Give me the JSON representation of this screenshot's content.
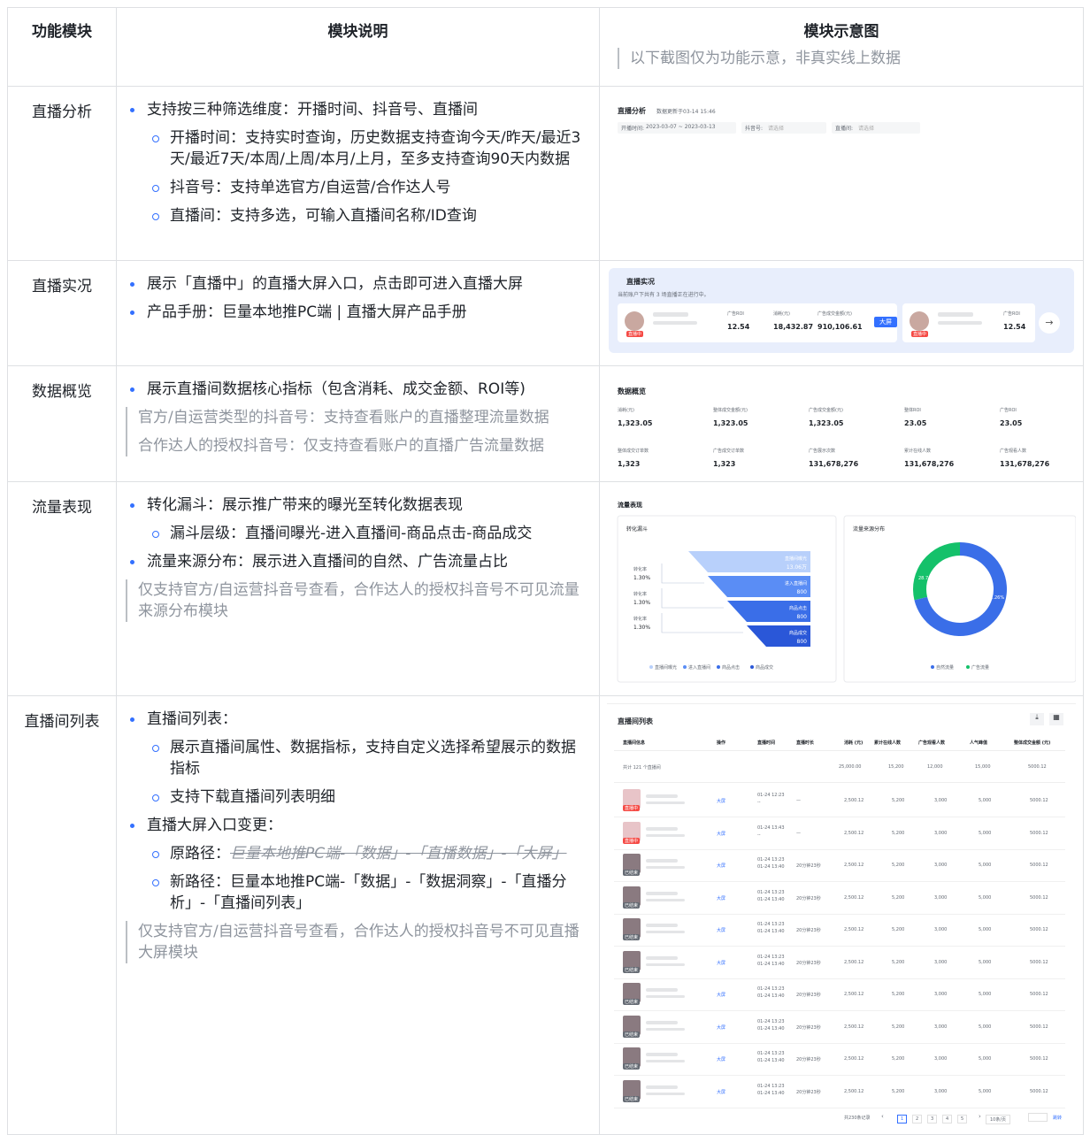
{
  "header": {
    "col1": "功能模块",
    "col2": "模块说明",
    "col3": "模块示意图",
    "col3_hint": "以下截图仅为功能示意，非真实线上数据"
  },
  "rows": [
    {
      "module": "直播分析",
      "items": [
        {
          "level": 1,
          "text": "支持按三种筛选维度：开播时间、抖音号、直播间"
        },
        {
          "level": 2,
          "text": "开播时间：支持实时查询，历史数据支持查询今天/昨天/最近3天/最近7天/本周/上周/本月/上月，至多支持查询90天内数据"
        },
        {
          "level": 2,
          "text": "抖音号：支持单选官方/自运营/合作达人号"
        },
        {
          "level": 2,
          "text": "直播间：支持多选，可输入直播间名称/ID查询"
        }
      ]
    },
    {
      "module": "直播实况",
      "items": [
        {
          "level": 1,
          "text": "展示「直播中」的直播大屏入口，点击即可进入直播大屏"
        },
        {
          "level": 1,
          "text": "产品手册：巨量本地推PC端 | 直播大屏产品手册"
        }
      ]
    },
    {
      "module": "数据概览",
      "items": [
        {
          "level": 1,
          "text": "展示直播间数据核心指标（包含消耗、成交金额、ROI等)"
        }
      ],
      "quotes": [
        "官方/自运营类型的抖音号：支持查看账户的直播整理流量数据",
        "合作达人的授权抖音号：仅支持查看账户的直播广告流量数据"
      ]
    },
    {
      "module": "流量表现",
      "items": [
        {
          "level": 1,
          "text": "转化漏斗：展示推广带来的曝光至转化数据表现"
        },
        {
          "level": 2,
          "text": "漏斗层级：直播间曝光-进入直播间-商品点击-商品成交"
        },
        {
          "level": 1,
          "text": "流量来源分布：展示进入直播间的自然、广告流量占比"
        }
      ],
      "quotes": [
        "仅支持官方/自运营抖音号查看，合作达人的授权抖音号不可见流量来源分布模块"
      ]
    },
    {
      "module": "直播间列表",
      "items": [
        {
          "level": 1,
          "text": "直播间列表："
        },
        {
          "level": 2,
          "text": "展示直播间属性、数据指标，支持自定义选择希望展示的数据指标"
        },
        {
          "level": 2,
          "text": "支持下载直播间列表明细"
        },
        {
          "level": 1,
          "text": "直播大屏入口变更："
        }
      ],
      "old_path_label": "原路径：",
      "old_path": "巨量本地推PC端-「数据」-「直播数据」-「大屏」",
      "new_path": "新路径：巨量本地推PC端-「数据」-「数据洞察」-「直播分析」-「直播间列表」",
      "quotes": [
        "仅支持官方/自运营抖音号查看，合作达人的授权抖音号不可见直播大屏模块"
      ]
    }
  ],
  "shot1": {
    "title": "直播分析",
    "update": "数据更新于03-14 15:46",
    "date_label": "开播时间:",
    "date_value": "2023-03-07 ~ 2023-03-13",
    "account_label": "抖音号:",
    "account_ph": "请选择",
    "room_label": "直播间:",
    "room_ph": "请选择"
  },
  "shot2": {
    "title": "直播实况",
    "sub": "当前账户下共有 3 场直播正在进行中。",
    "roi_label": "广告ROI",
    "roi": "12.54",
    "cost_label": "消耗(元)",
    "cost": "18,432.87",
    "gmv_label": "广告成交金额(元)",
    "gmv": "910,106.61",
    "btn": "大屏",
    "live_tag": "直播中",
    "roi2": "12.54"
  },
  "shot3": {
    "title": "数据概览",
    "row1": [
      {
        "label": "消耗(元)",
        "value": "1,323.05"
      },
      {
        "label": "整体成交金额(元)",
        "value": "1,323.05"
      },
      {
        "label": "广告成交金额(元)",
        "value": "1,323.05"
      },
      {
        "label": "整体ROI",
        "value": "23.05"
      },
      {
        "label": "广告ROI",
        "value": "23.05"
      }
    ],
    "row2": [
      {
        "label": "整体成交订单数",
        "value": "1,323"
      },
      {
        "label": "广告成交订单数",
        "value": "1,323"
      },
      {
        "label": "广告展示次数",
        "value": "131,678,276"
      },
      {
        "label": "累计在线人数",
        "value": "131,678,276"
      },
      {
        "label": "广告观看人数",
        "value": "131,678,276"
      }
    ]
  },
  "shot4": {
    "title": "流量表现",
    "funnel_title": "转化漏斗",
    "source_title": "流量来源分布",
    "funnel": [
      {
        "name": "直播间曝光",
        "value": "13.06万"
      },
      {
        "name": "进入直播间",
        "value": "800"
      },
      {
        "name": "商品点击",
        "value": "800"
      },
      {
        "name": "商品成交",
        "value": "800"
      }
    ],
    "rate_label": "转化率",
    "rates": [
      "1.30%",
      "1.30%",
      "1.30%"
    ],
    "legend": [
      "直播间曝光",
      "进入直播间",
      "商品点击",
      "商品成交"
    ],
    "pie_natural": "28.74%",
    "pie_ad": "71.26%",
    "pie_legend": [
      "自然流量",
      "广告流量"
    ],
    "colors": {
      "natural": "#14c16a",
      "ad": "#3a6ee8"
    }
  },
  "shot5": {
    "title": "直播间列表",
    "headers": [
      "直播间信息",
      "操作",
      "直播时间",
      "直播时长",
      "消耗 (元)",
      "累计在线人数",
      "广告观看人数",
      "人气峰值",
      "整体成交金额 (元)"
    ],
    "total_label": "共计 121 个直播间",
    "totals": [
      "25,000.00",
      "15,200",
      "12,000",
      "15,000",
      "5000.12"
    ],
    "rows": [
      {
        "tag": "直播中",
        "op": "大屏",
        "time1": "01-24 12:23",
        "time2": "--",
        "dur": "—",
        "cost": "2,500.12",
        "online": "5,200",
        "viewers": "3,000",
        "peak": "5,000",
        "gmv": "5000.12"
      },
      {
        "tag": "直播中",
        "op": "大屏",
        "time1": "01-24 13:43",
        "time2": "--",
        "dur": "—",
        "cost": "2,500.12",
        "online": "5,200",
        "viewers": "3,000",
        "peak": "5,000",
        "gmv": "5000.12"
      },
      {
        "tag": "已结束",
        "op": "大屏",
        "time1": "01-24 13:23",
        "time2": "01-24 13:40",
        "dur": "20分钟23秒",
        "cost": "2,500.12",
        "online": "5,200",
        "viewers": "3,000",
        "peak": "5,000",
        "gmv": "5000.12"
      },
      {
        "tag": "已结束",
        "op": "大屏",
        "time1": "01-24 13:23",
        "time2": "01-24 13:40",
        "dur": "20分钟23秒",
        "cost": "2,500.12",
        "online": "5,200",
        "viewers": "3,000",
        "peak": "5,000",
        "gmv": "5000.12"
      },
      {
        "tag": "已结束",
        "op": "大屏",
        "time1": "01-24 13:23",
        "time2": "01-24 13:40",
        "dur": "20分钟23秒",
        "cost": "2,500.12",
        "online": "5,200",
        "viewers": "3,000",
        "peak": "5,000",
        "gmv": "5000.12"
      },
      {
        "tag": "已结束",
        "op": "大屏",
        "time1": "01-24 13:23",
        "time2": "01-24 13:40",
        "dur": "20分钟23秒",
        "cost": "2,500.12",
        "online": "5,200",
        "viewers": "3,000",
        "peak": "5,000",
        "gmv": "5000.12"
      },
      {
        "tag": "已结束",
        "op": "大屏",
        "time1": "01-24 13:23",
        "time2": "01-24 13:40",
        "dur": "20分钟23秒",
        "cost": "2,500.12",
        "online": "5,200",
        "viewers": "3,000",
        "peak": "5,000",
        "gmv": "5000.12"
      },
      {
        "tag": "已结束",
        "op": "大屏",
        "time1": "01-24 13:23",
        "time2": "01-24 13:40",
        "dur": "20分钟23秒",
        "cost": "2,500.12",
        "online": "5,200",
        "viewers": "3,000",
        "peak": "5,000",
        "gmv": "5000.12"
      },
      {
        "tag": "已结束",
        "op": "大屏",
        "time1": "01-24 13:23",
        "time2": "01-24 13:40",
        "dur": "20分钟23秒",
        "cost": "2,500.12",
        "online": "5,200",
        "viewers": "3,000",
        "peak": "5,000",
        "gmv": "5000.12"
      },
      {
        "tag": "已结束",
        "op": "大屏",
        "time1": "01-24 13:23",
        "time2": "01-24 13:40",
        "dur": "20分钟23秒",
        "cost": "2,500.12",
        "online": "5,200",
        "viewers": "3,000",
        "peak": "5,000",
        "gmv": "5000.12"
      }
    ],
    "pager_total": "共230条记录",
    "pages": [
      "1",
      "2",
      "3",
      "4",
      "5"
    ],
    "page_size": "10条/页",
    "goto": "跳转"
  }
}
